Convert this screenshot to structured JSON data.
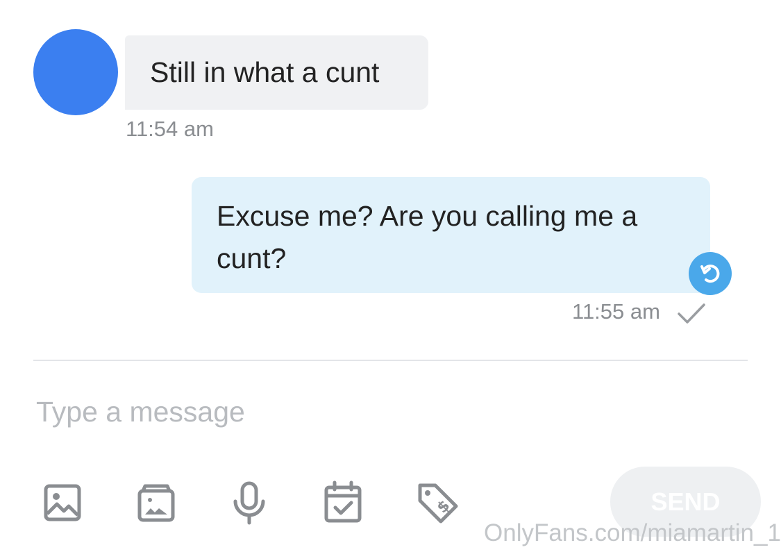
{
  "conversation": {
    "incoming": {
      "text": "Still in what a cunt",
      "time": "11:54 am",
      "avatar_color": "#3b7ff0"
    },
    "outgoing": {
      "text": "Excuse me? Are you calling me a cunt?",
      "time": "11:55 am",
      "status_icon": "checkmark-icon",
      "action_icon": "undo-icon"
    }
  },
  "composer": {
    "placeholder": "Type a message",
    "tools": [
      "image-icon",
      "media-vault-icon",
      "microphone-icon",
      "calendar-check-icon",
      "price-tag-icon"
    ],
    "send_label": "SEND"
  },
  "watermark": {
    "text": "OnlyFans.com/miamartin_1"
  },
  "colors": {
    "incoming_bubble": "#f0f1f3",
    "outgoing_bubble": "#e1f2fb",
    "accent": "#4aa8ea",
    "icon_gray": "#8a8d91"
  }
}
